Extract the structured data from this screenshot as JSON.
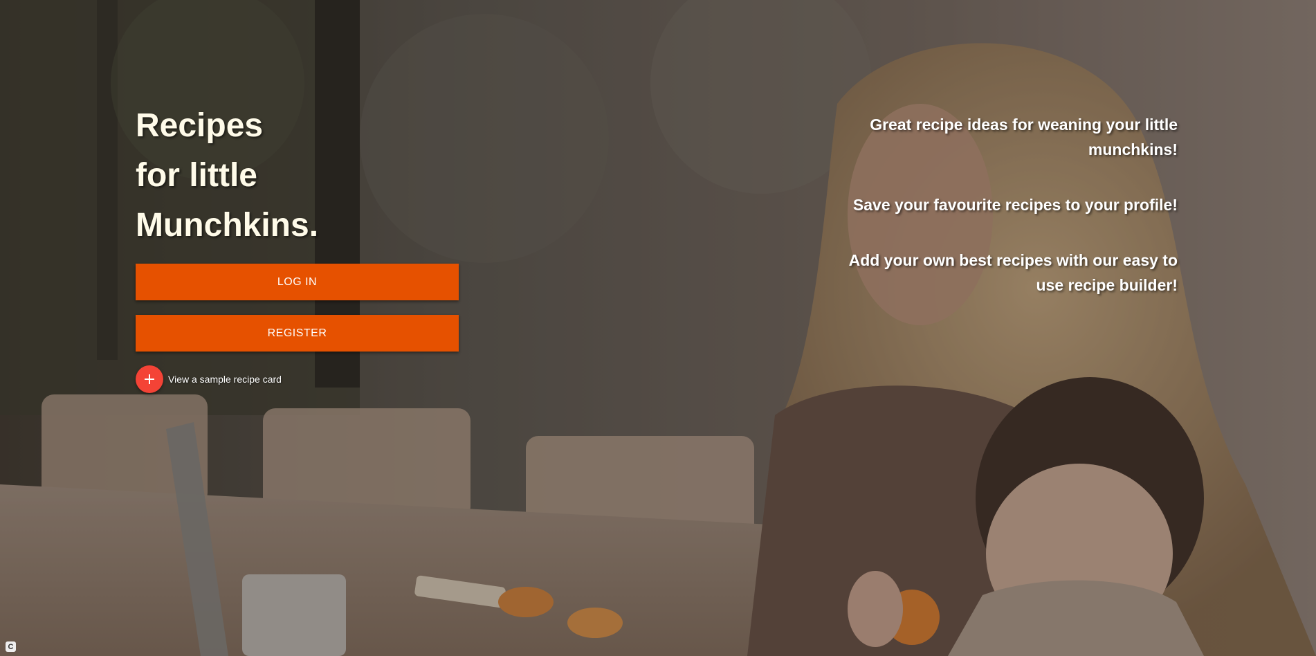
{
  "hero": {
    "headline_lines": [
      "Recipes",
      "for little",
      "Munchkins."
    ],
    "background_image": "mother-and-baby-at-table-photo"
  },
  "actions": {
    "login_label": "LOG IN",
    "register_label": "REGISTER",
    "sample_label": "View a sample recipe card",
    "sample_icon": "plus-icon"
  },
  "features": [
    "Great recipe ideas for weaning your little munchkins!",
    "Save your favourite recipes to your profile!",
    "Add your own best recipes with our easy to use recipe builder!"
  ],
  "corner_badge": "C",
  "colors": {
    "primary_button": "#e65100",
    "fab": "#f44336",
    "headline_text": "#fffbe9",
    "body_text": "#ffffff"
  }
}
